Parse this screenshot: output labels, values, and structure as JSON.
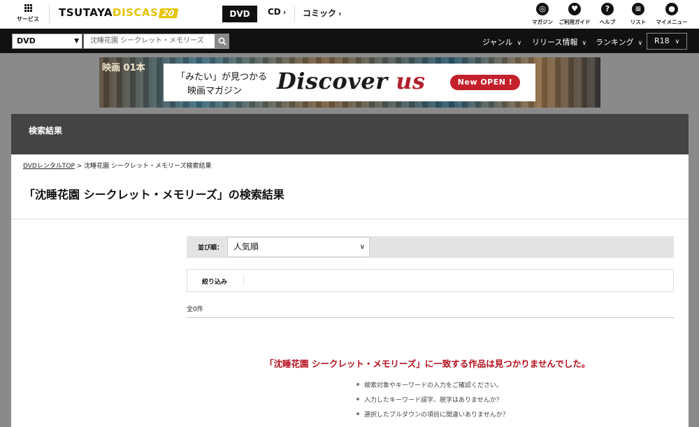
{
  "header": {
    "services_label": "サービス",
    "logo": {
      "main": "TSUTAYA",
      "accent": "DISCAS",
      "badge": "20"
    },
    "categories": {
      "active": "DVD",
      "cd": "CD",
      "comic": "コミック"
    },
    "icons": [
      {
        "icon": "magazine-icon",
        "label": "マガジン"
      },
      {
        "icon": "guide-icon",
        "label": "ご利用ガイド"
      },
      {
        "icon": "help-icon",
        "label": "ヘルプ"
      },
      {
        "icon": "list-icon",
        "label": "リスト"
      },
      {
        "icon": "mymenu-icon",
        "label": "マイメニュー"
      }
    ]
  },
  "searchbar": {
    "category_select": "DVD",
    "query": "沈睡花園 シークレット・メモリーズ",
    "nav": {
      "genre": "ジャンル",
      "release": "リリース情報",
      "ranking": "ランキング",
      "r18": "R18"
    }
  },
  "banner": {
    "tagline1": "「みたい」が見つかる",
    "tagline2": "映画マガジン",
    "title_main": "Discover",
    "title_accent": "us",
    "cta": "New OPEN !",
    "bg_text": "映画 01本"
  },
  "main": {
    "header_title": "検索結果",
    "breadcrumb": {
      "home": "DVDレンタルTOP",
      "sep": " > ",
      "current": "沈睡花園 シークレット・メモリーズ検索結果"
    },
    "heading": "「沈睡花園 シークレット・メモリーズ」の検索結果",
    "sort": {
      "label": "並び順：",
      "value": "人気順"
    },
    "filter_label": "絞り込み",
    "count": "全0件",
    "not_found": "「沈睡花園 シークレット・メモリーズ」に一致する作品は見つかりませんでした。",
    "tips": [
      "検索対象やキーワードの入力をご確認ください。",
      "入力したキーワード誤字、脱字はありませんか？",
      "選択したプルダウンの項目に間違いありませんか？"
    ]
  },
  "colors": {
    "accent_red": "#b3101c",
    "logo_yellow": "#e6c300",
    "header_dark": "#444444"
  }
}
